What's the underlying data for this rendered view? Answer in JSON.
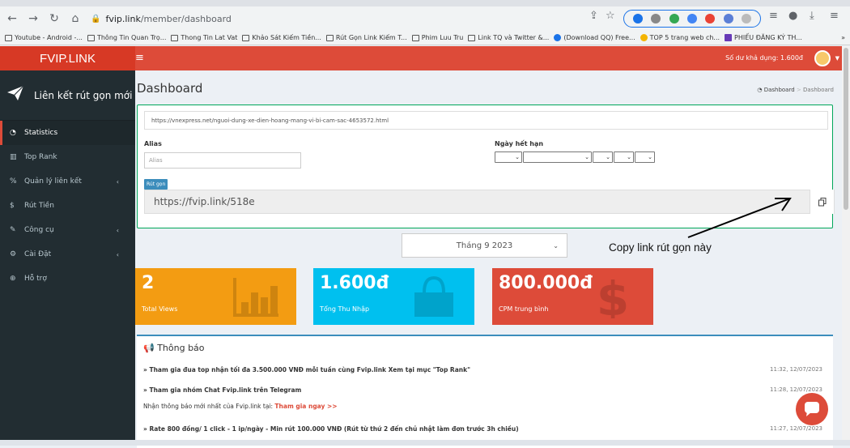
{
  "browser": {
    "url_domain": "fvip.link",
    "url_path": "/member/dashboard",
    "bookmarks": [
      "Youtube - Android -...",
      "Thông Tin Quan Trọ...",
      "Thong Tin Lat Vat",
      "Khảo Sát Kiếm Tiền...",
      "Rút Gọn Link Kiếm T...",
      "Phim Luu Tru",
      "Link TQ và Twitter &...",
      "(Download QQ) Free...",
      "TOP 5 trang web ch...",
      "PHIẾU ĐĂNG KÝ TH..."
    ],
    "more": "»"
  },
  "app": {
    "logo": "FVIP.LINK",
    "balance": "Số dư khả dụng: 1.600đ"
  },
  "sidebar": {
    "title": "Liên kết rút gọn mới",
    "items": [
      {
        "label": "Statistics",
        "icon": "dashboard-icon"
      },
      {
        "label": "Top Rank",
        "icon": "bar-chart-icon"
      },
      {
        "label": "Quản lý liên kết",
        "icon": "link-icon",
        "arrow": "‹"
      },
      {
        "label": "Rút Tiền",
        "icon": "dollar-icon"
      },
      {
        "label": "Công cụ",
        "icon": "wrench-icon",
        "arrow": "‹"
      },
      {
        "label": "Cài Đặt",
        "icon": "gears-icon",
        "arrow": "‹"
      },
      {
        "label": "Hỗ trợ",
        "icon": "lifebuoy-icon"
      }
    ]
  },
  "main": {
    "title": "Dashboard",
    "breadcrumb": [
      "Dashboard",
      "Dashboard"
    ],
    "long_url": "https://vnexpress.net/nguoi-dung-xe-dien-hoang-mang-vi-bi-cam-sac-4653572.html",
    "alias_label": "Alias",
    "alias_placeholder": "Alias",
    "expiry_label": "Ngày hết hạn",
    "shorten_button": "Rút gọn",
    "short_url": "https://fvip.link/518e",
    "month": "Tháng 9 2023",
    "annotation": "Copy link rút gọn này"
  },
  "stats": [
    {
      "value": "2",
      "label": "Total Views",
      "color": "#f39c12"
    },
    {
      "value": "1.600đ",
      "label": "Tổng Thu Nhập",
      "color": "#00c0ef"
    },
    {
      "value": "800.000đ",
      "label": "CPM trung bình",
      "color": "#dd4b39"
    }
  ],
  "notice": {
    "title": "Thông báo",
    "items": [
      {
        "text": "» Tham gia đua top nhận tối đa 3.500.000 VNĐ mỗi tuần cùng Fvip.link Xem tại mục \"Top Rank\"",
        "time": "11:32, 12/07/2023"
      },
      {
        "text": "» Tham gia nhóm Chat Fvip.link trên Telegram",
        "time": "11:28, 12/07/2023",
        "sub": "Nhận thông báo mới nhất của Fvip.link tại:",
        "sub_link": "Tham gia ngay >>"
      },
      {
        "text": "» Rate 800 đồng/ 1 click - 1 ip/ngày - Min rút 100.000 VNĐ (Rút từ thứ 2 đến chủ nhật làm đơn trước 3h chiều)",
        "time": "11:27, 12/07/2023"
      }
    ]
  }
}
